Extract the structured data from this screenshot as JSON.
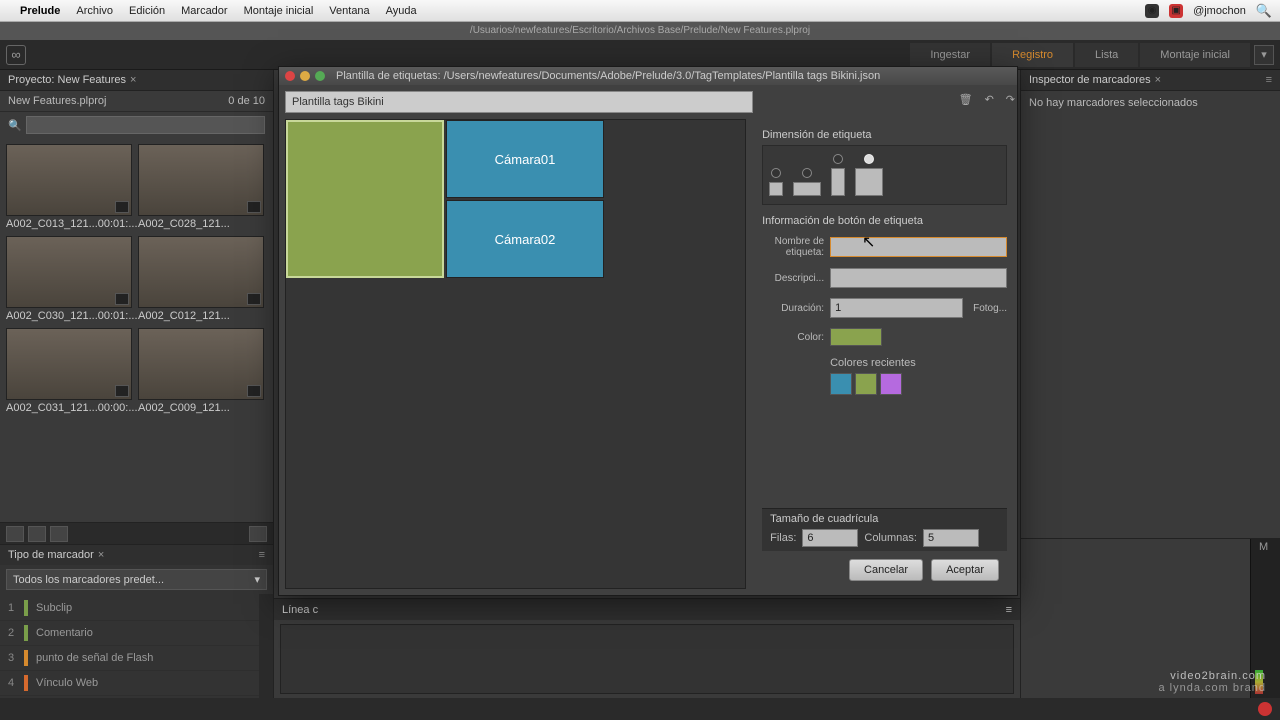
{
  "menubar": {
    "app": "Prelude",
    "items": [
      "Archivo",
      "Edición",
      "Marcador",
      "Montaje inicial",
      "Ventana",
      "Ayuda"
    ],
    "user": "@jmochon"
  },
  "pathbar": "/Usuarios/newfeatures/Escritorio/Archivos Base/Prelude/New Features.plproj",
  "appbar": {
    "tabs": [
      "Ingestar",
      "Registro",
      "Lista",
      "Montaje inicial"
    ],
    "active": 1
  },
  "project": {
    "title": "Proyecto: New Features",
    "filename": "New Features.plproj",
    "count": "0 de 10",
    "clips": [
      {
        "name": "A002_C013_121...",
        "dur": "00:01:..."
      },
      {
        "name": "A002_C028_121...",
        "dur": ""
      },
      {
        "name": "A002_C030_121...",
        "dur": "00:01:..."
      },
      {
        "name": "A002_C012_121...",
        "dur": ""
      },
      {
        "name": "A002_C031_121...",
        "dur": "00:00:..."
      },
      {
        "name": "A002_C009_121...",
        "dur": ""
      }
    ]
  },
  "markerPanel": {
    "title": "Tipo de marcador",
    "dropdown": "Todos los marcadores predet...",
    "items": [
      {
        "n": "1",
        "label": "Subclip"
      },
      {
        "n": "2",
        "label": "Comentario"
      },
      {
        "n": "3",
        "label": "punto de señal de Flash"
      },
      {
        "n": "4",
        "label": "Vínculo Web"
      }
    ]
  },
  "timeline": {
    "tab": "Línea c"
  },
  "inspector": {
    "title": "Inspector de marcadores",
    "msg": "No hay marcadores seleccionados"
  },
  "audio": {
    "label": "M"
  },
  "dialog": {
    "windowTitle": "Plantilla de etiquetas: /Users/newfeatures/Documents/Adobe/Prelude/3.0/TagTemplates/Plantilla tags Bikini.json",
    "templateName": "Plantilla tags Bikini",
    "tags": {
      "green": "",
      "blue1": "Cámara01",
      "blue2": "Cámara02"
    },
    "dimSection": "Dimensión de etiqueta",
    "infoSection": "Información de botón de etiqueta",
    "form": {
      "nameLabel": "Nombre de etiqueta:",
      "nameValue": "",
      "descLabel": "Descripci...",
      "descValue": "",
      "durLabel": "Duración:",
      "durValue": "1",
      "durUnit": "Fotog...",
      "colorLabel": "Color:",
      "recentLabel": "Colores recientes"
    },
    "recentColors": [
      "#3a8fb0",
      "#8aa34e",
      "#b56adf"
    ],
    "gridSection": "Tamaño de cuadrícula",
    "grid": {
      "rowsLabel": "Filas:",
      "rows": "6",
      "colsLabel": "Columnas:",
      "cols": "5"
    },
    "buttons": {
      "cancel": "Cancelar",
      "ok": "Aceptar"
    }
  },
  "watermark": {
    "l1": "video2brain.com",
    "l2": "a lynda.com brand"
  }
}
